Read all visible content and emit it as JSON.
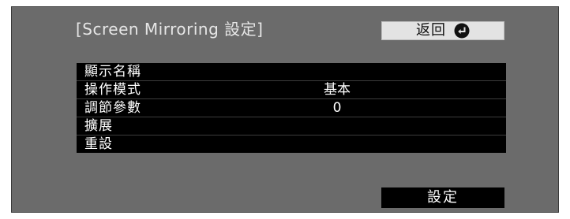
{
  "dialog": {
    "title": "[Screen Mirroring 設定]"
  },
  "header": {
    "back_label": "返回",
    "back_icon": "enter-return-icon"
  },
  "menu": {
    "items": [
      {
        "label": "顯示名稱",
        "value": ""
      },
      {
        "label": "操作模式",
        "value": "基本"
      },
      {
        "label": "調節參數",
        "value": "0"
      },
      {
        "label": "擴展",
        "value": ""
      },
      {
        "label": "重設",
        "value": ""
      }
    ]
  },
  "footer": {
    "set_label": "設定"
  },
  "colors": {
    "panel_background": "#6b6b6b",
    "menu_background": "#000000",
    "button_background": "#e3e3e3",
    "text_light": "#ffffff"
  }
}
